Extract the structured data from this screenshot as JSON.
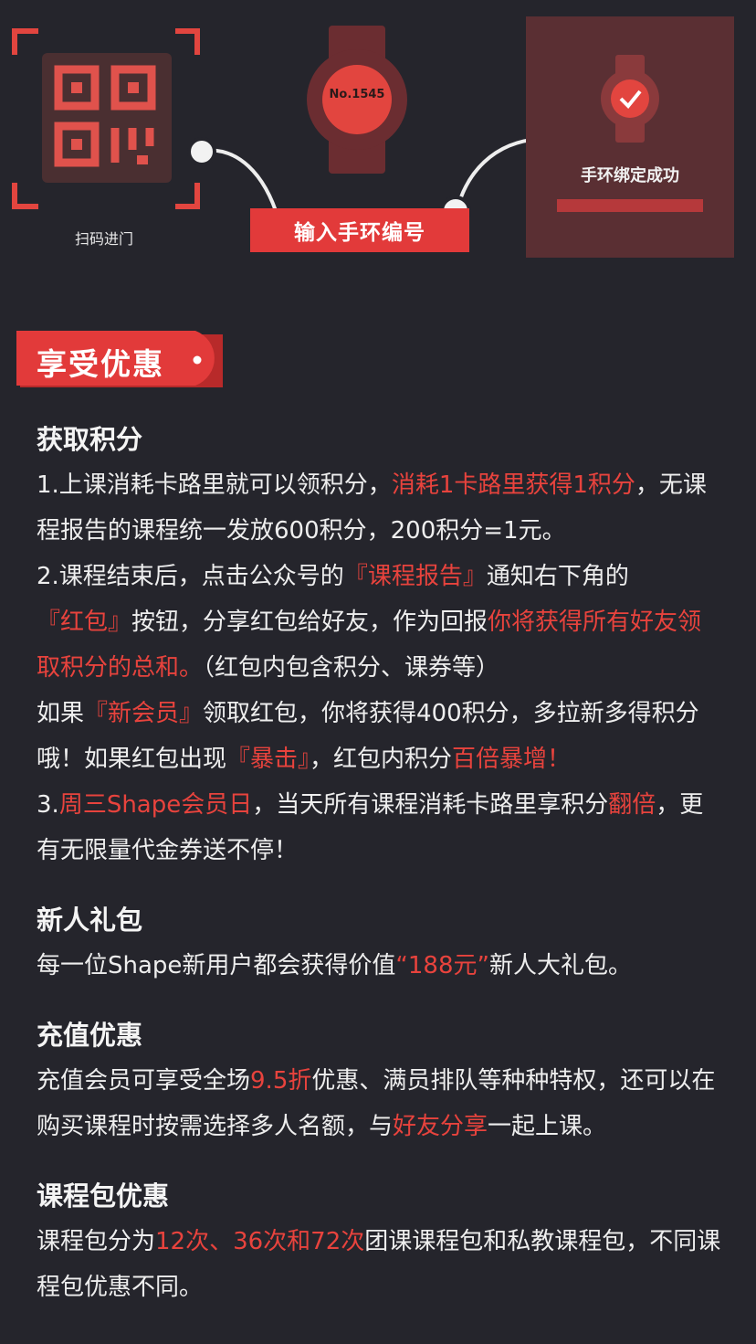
{
  "flow": {
    "scan_label": "扫码进门",
    "input_button": "输入手环编号",
    "watch_number": "No.1545",
    "success_label": "手环绑定成功"
  },
  "banner": {
    "title": "享受优惠"
  },
  "sections": {
    "points": {
      "title": "获取积分",
      "l1a": "1.上课消耗卡路里就可以领积分，",
      "l1b": "消耗1卡路里获得1积分",
      "l1c": "，无课程报告的课程统一发放600积分，200积分=1元。",
      "l2a": "2.课程结束后，点击公众号的",
      "l2b": "『课程报告』",
      "l2c": "通知右下角的",
      "l2d": "『红包』",
      "l2e": "按钮，分享红包给好友，作为回报",
      "l2f": "你将获得所有好友领取积分的总和。",
      "l2g": "（红包内包含积分、课券等）",
      "l3a": "如果",
      "l3b": "『新会员』",
      "l3c": "领取红包，你将获得400积分，多拉新多得积分哦！如果红包出现",
      "l3d": "『暴击』",
      "l3e": "，红包内积分",
      "l3f": "百倍暴增！",
      "l4a": "3.",
      "l4b": "周三Shape会员日",
      "l4c": "，当天所有课程消耗卡路里享积分",
      "l4d": "翻倍",
      "l4e": "，更有无限量代金券送不停！"
    },
    "newbie": {
      "title": "新人礼包",
      "a": "每一位Shape新用户都会获得价值",
      "b": "“188元”",
      "c": "新人大礼包。"
    },
    "recharge": {
      "title": "充值优惠",
      "a": "充值会员可享受全场",
      "b": "9.5折",
      "c": "优惠、满员排队等种种特权，还可以在购买课程时按需选择多人名额，与",
      "d": "好友分享",
      "e": "一起上课。"
    },
    "package": {
      "title": "课程包优惠",
      "a": "课程包分为",
      "b": "12次、36次和72次",
      "c": "团课课程包和私教课程包，不同课程包优惠不同。"
    }
  },
  "colors": {
    "accent": "#e23a3a",
    "background": "#25252c",
    "panel": "#5a2f33"
  }
}
